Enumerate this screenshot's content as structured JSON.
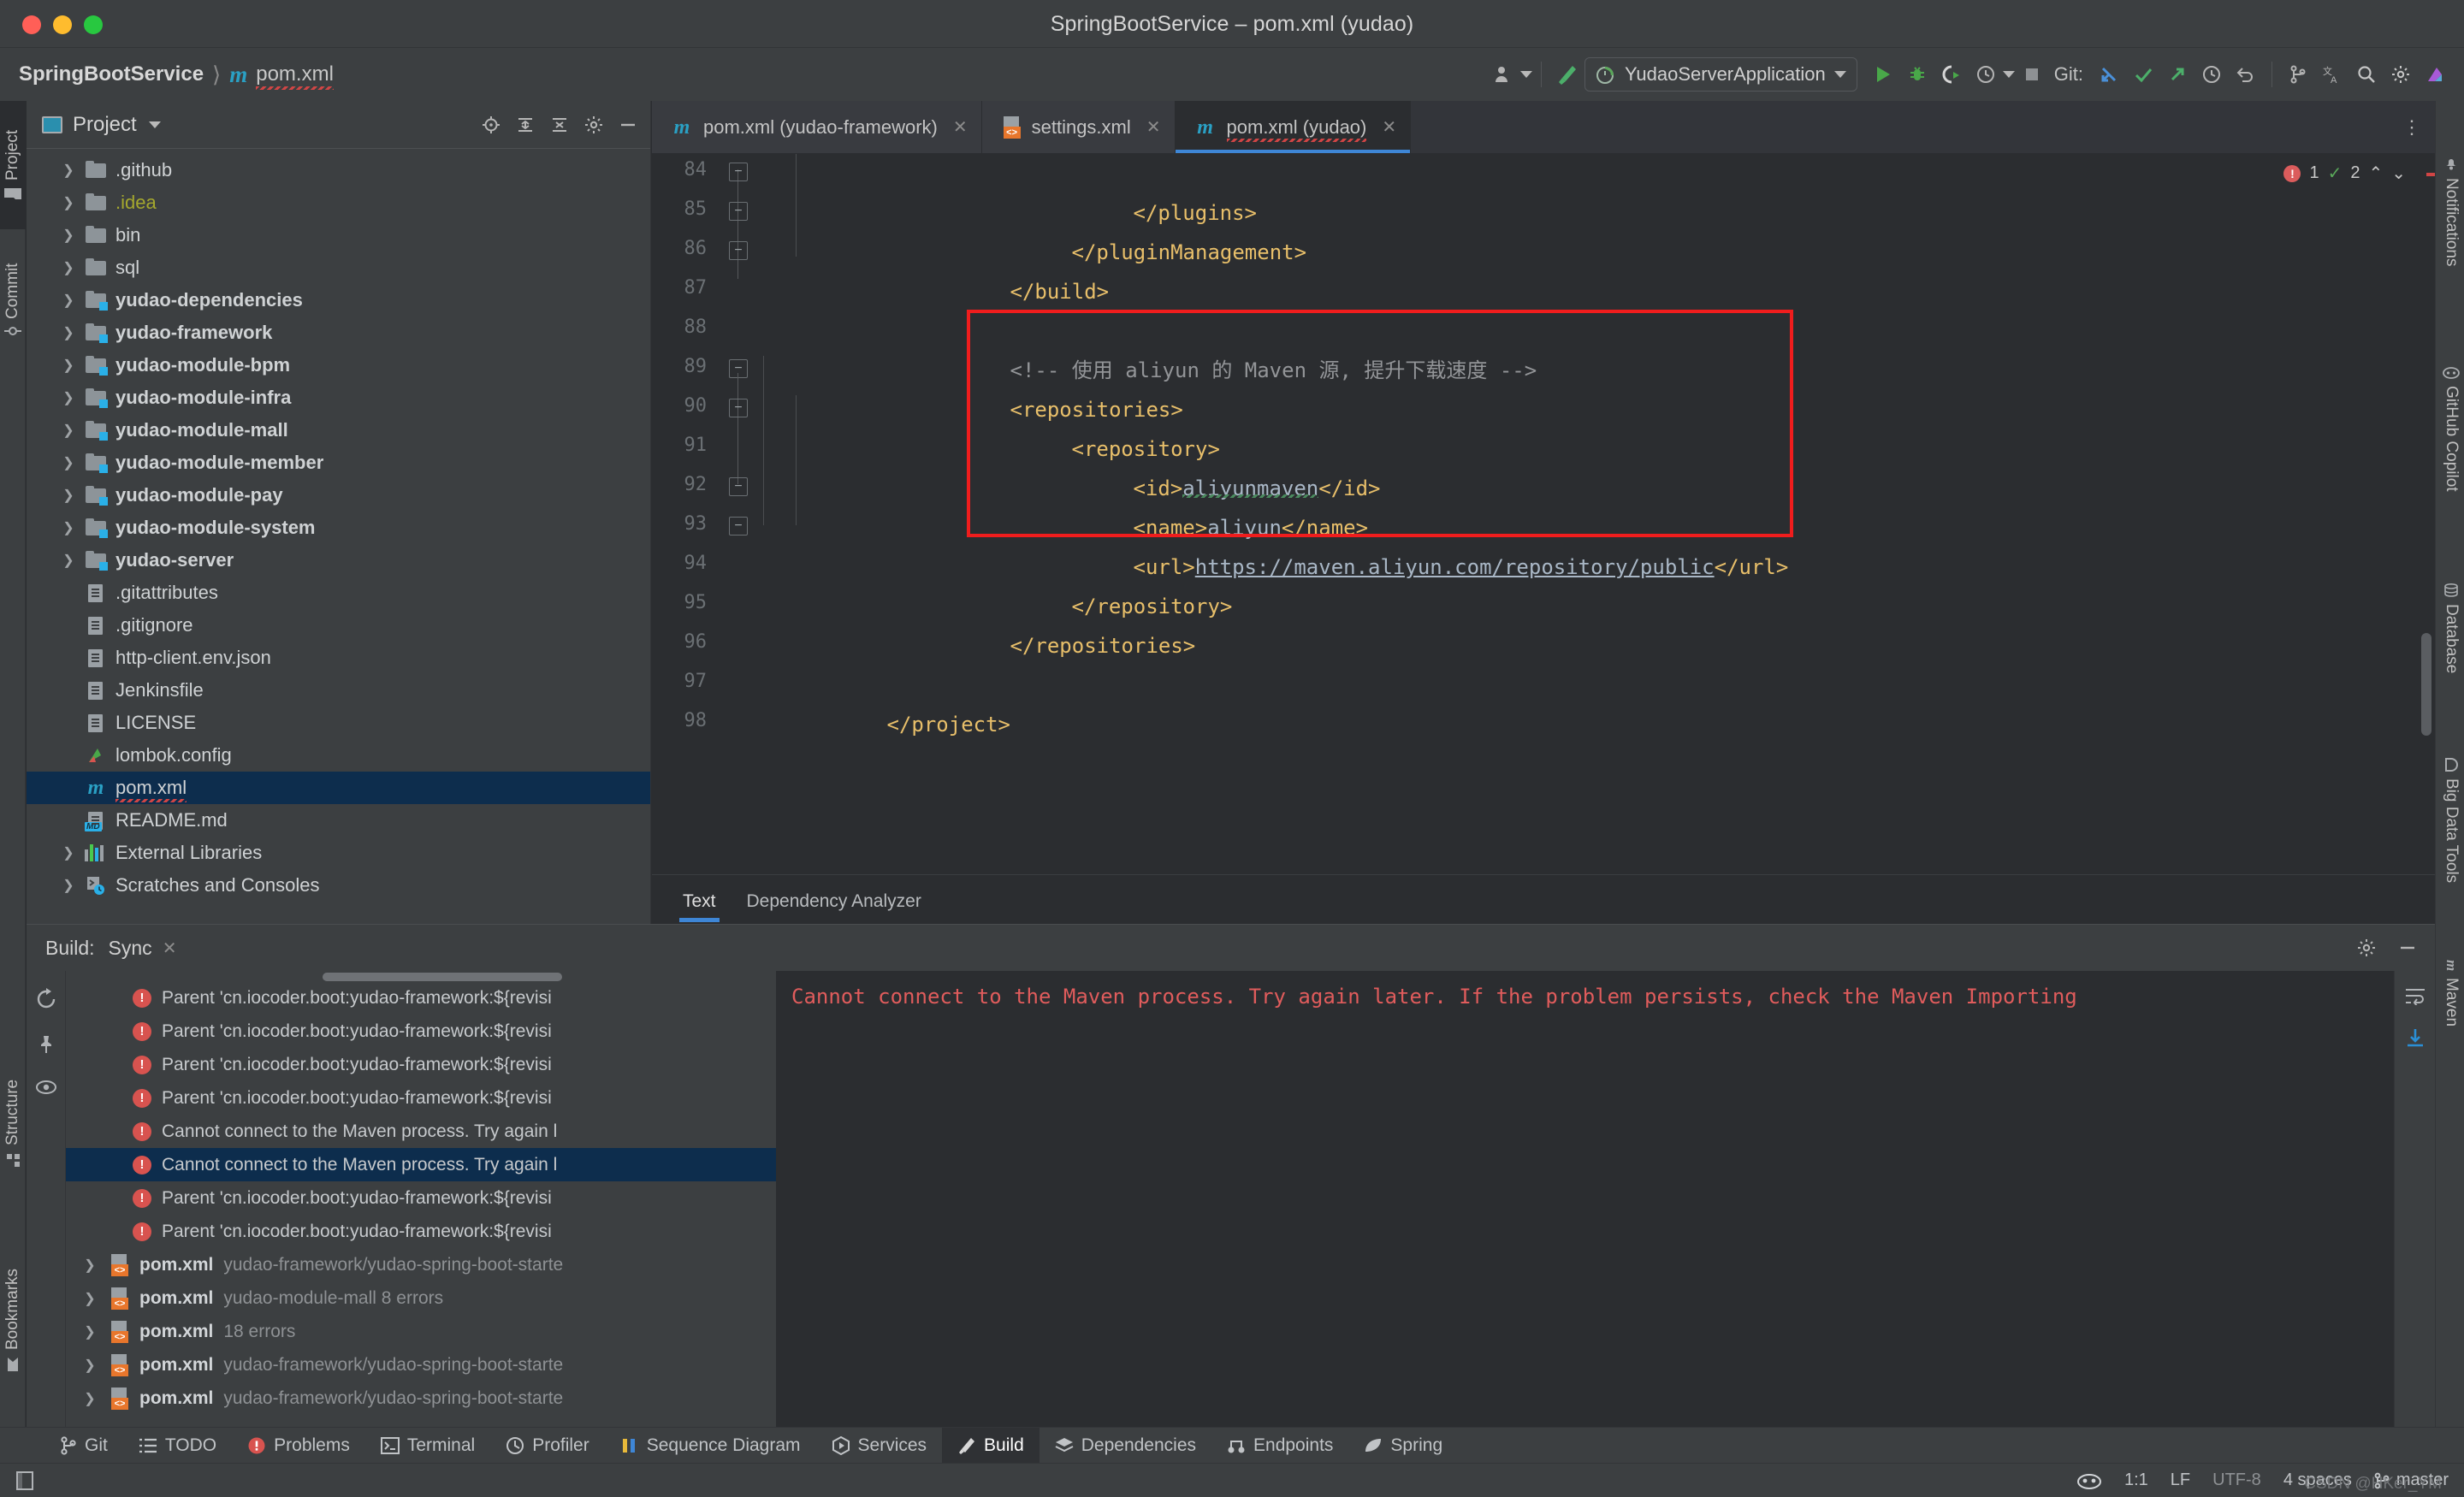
{
  "window": {
    "title": "SpringBootService – pom.xml (yudao)"
  },
  "breadcrumb": {
    "project": "SpringBootService",
    "separator": "⟩",
    "maven_icon": "m",
    "file": "pom.xml"
  },
  "toolbar": {
    "run_config": "YudaoServerApplication",
    "git_label": "Git:",
    "icons": [
      "account-icon",
      "build-hammer-icon",
      "run-icon",
      "debug-icon",
      "run-coverage-icon",
      "profiler-icon",
      "stop-icon",
      "git-update-icon",
      "git-commit-icon",
      "git-push-icon",
      "history-icon",
      "rollback-icon",
      "git-branch-icon",
      "translate-icon",
      "search-everywhere-icon",
      "settings-icon",
      "ai-icon"
    ]
  },
  "left_strip": {
    "items": [
      {
        "label": "Project",
        "icon": "folder-icon",
        "active": true
      },
      {
        "label": "Commit",
        "icon": "commit-icon",
        "active": false
      },
      {
        "label": "Structure",
        "icon": "structure-icon",
        "active": false
      },
      {
        "label": "Bookmarks",
        "icon": "bookmark-icon",
        "active": false
      }
    ]
  },
  "right_strip": {
    "items": [
      {
        "label": "Notifications",
        "icon": "bell-icon"
      },
      {
        "label": "GitHub Copilot",
        "icon": "copilot-icon"
      },
      {
        "label": "Database",
        "icon": "database-icon"
      },
      {
        "label": "Big Data Tools",
        "icon": "bigdata-icon"
      },
      {
        "label": "Maven",
        "icon": "maven-icon"
      }
    ]
  },
  "project_panel": {
    "title": "Project",
    "tree": [
      {
        "label": ".github",
        "icon": "folder-icon",
        "arrow": true,
        "style": "plain"
      },
      {
        "label": ".idea",
        "icon": "folder-icon",
        "arrow": true,
        "style": "idea"
      },
      {
        "label": "bin",
        "icon": "folder-icon",
        "arrow": true,
        "style": "plain"
      },
      {
        "label": "sql",
        "icon": "folder-icon",
        "arrow": true,
        "style": "plain"
      },
      {
        "label": "yudao-dependencies",
        "icon": "module-icon",
        "arrow": true,
        "style": "bold"
      },
      {
        "label": "yudao-framework",
        "icon": "module-icon",
        "arrow": true,
        "style": "bold"
      },
      {
        "label": "yudao-module-bpm",
        "icon": "module-icon",
        "arrow": true,
        "style": "bold"
      },
      {
        "label": "yudao-module-infra",
        "icon": "module-icon",
        "arrow": true,
        "style": "bold"
      },
      {
        "label": "yudao-module-mall",
        "icon": "module-icon",
        "arrow": true,
        "style": "bold"
      },
      {
        "label": "yudao-module-member",
        "icon": "module-icon",
        "arrow": true,
        "style": "bold"
      },
      {
        "label": "yudao-module-pay",
        "icon": "module-icon",
        "arrow": true,
        "style": "bold"
      },
      {
        "label": "yudao-module-system",
        "icon": "module-icon",
        "arrow": true,
        "style": "bold"
      },
      {
        "label": "yudao-server",
        "icon": "module-icon",
        "arrow": true,
        "style": "bold"
      },
      {
        "label": ".gitattributes",
        "icon": "file-icon",
        "arrow": false,
        "style": "plain"
      },
      {
        "label": ".gitignore",
        "icon": "gitignore-icon",
        "arrow": false,
        "style": "plain"
      },
      {
        "label": "http-client.env.json",
        "icon": "http-json-icon",
        "arrow": false,
        "style": "plain"
      },
      {
        "label": "Jenkinsfile",
        "icon": "file-icon",
        "arrow": false,
        "style": "plain"
      },
      {
        "label": "LICENSE",
        "icon": "file-icon",
        "arrow": false,
        "style": "plain"
      },
      {
        "label": "lombok.config",
        "icon": "lombok-icon",
        "arrow": false,
        "style": "plain"
      },
      {
        "label": "pom.xml",
        "icon": "maven-icon",
        "arrow": false,
        "style": "selected"
      },
      {
        "label": "README.md",
        "icon": "markdown-icon",
        "arrow": false,
        "style": "plain"
      },
      {
        "label": "External Libraries",
        "icon": "library-icon",
        "arrow": true,
        "style": "plain"
      },
      {
        "label": "Scratches and Consoles",
        "icon": "scratches-icon",
        "arrow": true,
        "style": "plain"
      }
    ]
  },
  "editor": {
    "tabs": [
      {
        "label": "pom.xml (yudao-framework)",
        "icon": "maven-icon",
        "active": false,
        "error": false
      },
      {
        "label": "settings.xml",
        "icon": "xml-icon",
        "active": false,
        "error": false
      },
      {
        "label": "pom.xml (yudao)",
        "icon": "maven-icon",
        "active": true,
        "error": true
      }
    ],
    "inspection": {
      "error_count": "1",
      "warning_count": "2"
    },
    "bottom_tabs": [
      {
        "label": "Text",
        "active": true
      },
      {
        "label": "Dependency Analyzer",
        "active": false
      }
    ],
    "line_numbers": [
      "84",
      "85",
      "86",
      "87",
      "88",
      "89",
      "90",
      "91",
      "92",
      "93",
      "94",
      "95",
      "96",
      "97",
      "98"
    ],
    "lines": [
      {
        "num": "84",
        "indent": 8,
        "segments": [
          {
            "t": "tag",
            "v": "</plugins>"
          }
        ]
      },
      {
        "num": "85",
        "indent": 6,
        "segments": [
          {
            "t": "tag",
            "v": "</pluginManagement>"
          }
        ]
      },
      {
        "num": "86",
        "indent": 4,
        "segments": [
          {
            "t": "tag",
            "v": "</build>"
          }
        ]
      },
      {
        "num": "87",
        "indent": 0,
        "segments": []
      },
      {
        "num": "88",
        "indent": 4,
        "segments": [
          {
            "t": "cmt",
            "v": "<!-- 使用 aliyun 的 Maven 源, 提升下载速度 -->"
          }
        ]
      },
      {
        "num": "89",
        "indent": 4,
        "segments": [
          {
            "t": "tag",
            "v": "<repositories>"
          }
        ]
      },
      {
        "num": "90",
        "indent": 6,
        "segments": [
          {
            "t": "tag",
            "v": "<repository>"
          }
        ]
      },
      {
        "num": "91",
        "indent": 8,
        "segments": [
          {
            "t": "tag",
            "v": "<id>"
          },
          {
            "t": "squig",
            "v": "aliyunmaven"
          },
          {
            "t": "tag",
            "v": "</id>"
          }
        ]
      },
      {
        "num": "92",
        "indent": 8,
        "segments": [
          {
            "t": "tag",
            "v": "<name>"
          },
          {
            "t": "txt",
            "v": "aliyun"
          },
          {
            "t": "tag",
            "v": "</name>"
          }
        ]
      },
      {
        "num": "93",
        "indent": 8,
        "segments": [
          {
            "t": "tag",
            "v": "<url>"
          },
          {
            "t": "lnk",
            "v": "https://maven.aliyun.com/repository/public"
          },
          {
            "t": "tag",
            "v": "</url>"
          }
        ]
      },
      {
        "num": "94",
        "indent": 6,
        "segments": [
          {
            "t": "tag",
            "v": "</repository>"
          }
        ]
      },
      {
        "num": "95",
        "indent": 4,
        "segments": [
          {
            "t": "tag",
            "v": "</repositories>"
          }
        ]
      },
      {
        "num": "96",
        "indent": 0,
        "segments": []
      },
      {
        "num": "97",
        "indent": 0,
        "segments": [
          {
            "t": "tag",
            "v": "</project>"
          }
        ]
      },
      {
        "num": "98",
        "indent": 0,
        "segments": []
      }
    ]
  },
  "build_panel": {
    "header_label": "Build:",
    "header_tab": "Sync",
    "tree": [
      {
        "kind": "error",
        "text": "Parent 'cn.iocoder.boot:yudao-framework:${revisi",
        "selected": false
      },
      {
        "kind": "error",
        "text": "Parent 'cn.iocoder.boot:yudao-framework:${revisi",
        "selected": false
      },
      {
        "kind": "error",
        "text": "Parent 'cn.iocoder.boot:yudao-framework:${revisi",
        "selected": false
      },
      {
        "kind": "error",
        "text": "Parent 'cn.iocoder.boot:yudao-framework:${revisi",
        "selected": false
      },
      {
        "kind": "error",
        "text": "Cannot connect to the Maven process. Try again l",
        "selected": false
      },
      {
        "kind": "error",
        "text": "Cannot connect to the Maven process. Try again l",
        "selected": true
      },
      {
        "kind": "error",
        "text": "Parent 'cn.iocoder.boot:yudao-framework:${revisi",
        "selected": false
      },
      {
        "kind": "error",
        "text": "Parent 'cn.iocoder.boot:yudao-framework:${revisi",
        "selected": false
      },
      {
        "kind": "file",
        "name": "pom.xml",
        "detail": "yudao-framework/yudao-spring-boot-starte",
        "selected": false
      },
      {
        "kind": "file",
        "name": "pom.xml",
        "detail": "yudao-module-mall 8 errors",
        "selected": false
      },
      {
        "kind": "file",
        "name": "pom.xml",
        "detail": "18 errors",
        "selected": false
      },
      {
        "kind": "file",
        "name": "pom.xml",
        "detail": "yudao-framework/yudao-spring-boot-starte",
        "selected": false
      },
      {
        "kind": "file",
        "name": "pom.xml",
        "detail": "yudao-framework/yudao-spring-boot-starte",
        "selected": false
      }
    ],
    "detail_message": "Cannot connect to the Maven process. Try again later. If the problem persists, check the Maven Importing"
  },
  "tool_window_bar": {
    "items": [
      {
        "label": "Git",
        "icon": "git-icon",
        "active": false
      },
      {
        "label": "TODO",
        "icon": "todo-icon",
        "active": false
      },
      {
        "label": "Problems",
        "icon": "problems-icon",
        "active": false
      },
      {
        "label": "Terminal",
        "icon": "terminal-icon",
        "active": false
      },
      {
        "label": "Profiler",
        "icon": "profiler-icon",
        "active": false
      },
      {
        "label": "Sequence Diagram",
        "icon": "sequence-diagram-icon",
        "active": false
      },
      {
        "label": "Services",
        "icon": "services-icon",
        "active": false
      },
      {
        "label": "Build",
        "icon": "build-icon",
        "active": true
      },
      {
        "label": "Dependencies",
        "icon": "dependencies-icon",
        "active": false
      },
      {
        "label": "Endpoints",
        "icon": "endpoints-icon",
        "active": false
      },
      {
        "label": "Spring",
        "icon": "spring-icon",
        "active": false
      }
    ]
  },
  "status_bar": {
    "caret": "1:1",
    "line_separator": "LF",
    "encoding": "UTF-8",
    "indent": "4 spaces",
    "branch": "master",
    "watermark": "CSDN @HKer_YM"
  },
  "colors": {
    "accent_blue": "#3e86d6",
    "error_red": "#d8534f",
    "highlight_box": "#f01d1d",
    "tag_yellow": "#e8bf6a",
    "module_badge": "#2ab0e8"
  }
}
